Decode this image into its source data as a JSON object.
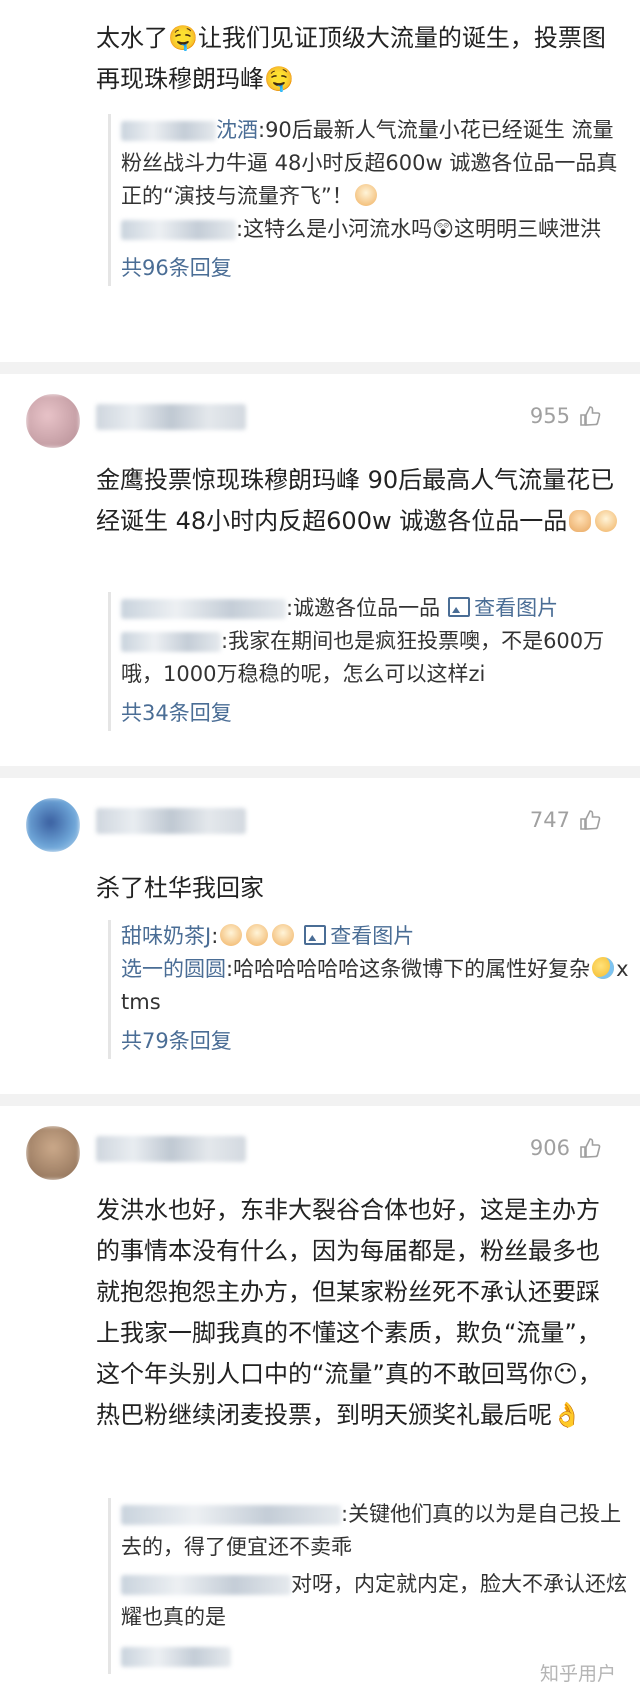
{
  "comment0": {
    "body": "太水了🤤让我们见证顶级大流量的诞生，投票图再现珠穆朗玛峰🤤",
    "replies": [
      {
        "name_suffix": "沈酒",
        "text": ":90后最新人气流量小花已经诞生 流量粉丝战斗力牛逼 48小时反超600w 诚邀各位品一品真正的“演技与流量齐飞”！"
      },
      {
        "name_suffix": "",
        "text": ":这特么是小河流水吗😲这明明三峡泄洪"
      }
    ],
    "more": "共96条回复"
  },
  "comment1": {
    "likes": "955",
    "body": "金鹰投票惊现珠穆朗玛峰 90后最高人气流量花已经诞生 48小时内反超600w 诚邀各位品一品",
    "replies": [
      {
        "name_suffix": "",
        "text": ":诚邀各位品一品",
        "pic": "查看图片"
      },
      {
        "name_suffix": "",
        "text": ":我家在期间也是疯狂投票噢，不是600万哦，1000万稳稳的呢，怎么可以这样zi"
      }
    ],
    "more": "共34条回复"
  },
  "comment2": {
    "likes": "747",
    "body": "杀了杜华我回家",
    "replies": [
      {
        "name": "甜味奶茶J",
        "text": ":",
        "pic": "查看图片"
      },
      {
        "name": "选一的圆圆",
        "text": ":哈哈哈哈哈哈这条微博下的属性好复杂",
        "tail": "xtms"
      }
    ],
    "more": "共79条回复"
  },
  "comment3": {
    "likes": "906",
    "body": "发洪水也好，东非大裂谷合体也好，这是主办方的事情本没有什么，因为每届都是，粉丝最多也就抱怨抱怨主办方，但某家粉丝死不承认还要踩上我家一脚我真的不懂这个素质，欺负“流量”，这个年头别人口中的“流量”真的不敢回骂你😶，热巴粉继续闭麦投票，到明天颁奖礼最后呢👌",
    "replies": [
      {
        "name_suffix": "",
        "text": ":关键他们真的以为是自己投上去的，得了便宜还不卖乖"
      },
      {
        "name_suffix": "",
        "text": "对呀，内定就内定，脸大不承认还炫耀也真的是"
      }
    ]
  },
  "watermark": "知乎用户",
  "colors": {
    "link": "#4a6d95",
    "muted": "#a0a0a0",
    "divider": "#f2f2f2"
  }
}
